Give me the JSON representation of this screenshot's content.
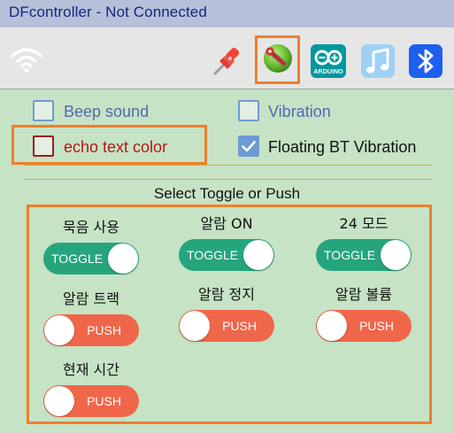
{
  "window": {
    "title": "DFcontroller - Not Connected"
  },
  "toolbar": {
    "icons": [
      "wifi-icon",
      "pin-icon",
      "settings-wrench-icon",
      "arduino-icon",
      "music-note-icon",
      "bluetooth-icon"
    ],
    "arduino_label": "ARDUINO",
    "highlight_color": "#f07e2a"
  },
  "options": {
    "beep_sound": {
      "label": "Beep sound",
      "checked": false
    },
    "vibration": {
      "label": "Vibration",
      "checked": false
    },
    "echo_text_color": {
      "label": "echo text color",
      "checked": false
    },
    "floating_bt_vibration": {
      "label": "Floating BT Vibration",
      "checked": true
    }
  },
  "section": {
    "heading": "Select Toggle or Push"
  },
  "buttons": [
    {
      "label": "묵음 사용",
      "mode": "TOGGLE"
    },
    {
      "label": "알람 ON",
      "mode": "TOGGLE"
    },
    {
      "label": "24 모드",
      "mode": "TOGGLE"
    },
    {
      "label": "알람 트랙",
      "mode": "PUSH"
    },
    {
      "label": "알람 정지",
      "mode": "PUSH"
    },
    {
      "label": "알람 볼륨",
      "mode": "PUSH"
    },
    {
      "label": "현재 시간",
      "mode": "PUSH"
    }
  ],
  "colors": {
    "toggle": "#26a57d",
    "push": "#f0664a",
    "background": "#c6e3c5",
    "title_bar": "#b6c1d9"
  }
}
